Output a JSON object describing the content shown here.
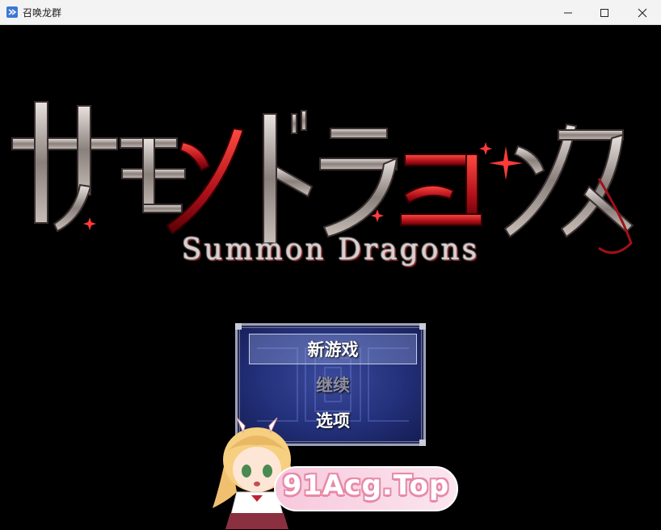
{
  "window": {
    "title": "召唤龙群",
    "minimize_icon": "minimize-icon",
    "maximize_icon": "maximize-icon",
    "close_icon": "close-icon"
  },
  "game": {
    "logo_text": "サモンドラゴンズ",
    "subtitle": "Summon Dragons",
    "menu": {
      "items": [
        {
          "label": "新游戏",
          "state": "selected"
        },
        {
          "label": "继续",
          "state": "disabled"
        },
        {
          "label": "选项",
          "state": "normal"
        }
      ]
    },
    "watermark": "91Acg.Top"
  },
  "colors": {
    "logo_red": "#c0141c",
    "logo_silver": "#b8b0ac",
    "menu_blue": "#23307a",
    "watermark_pink": "#f7c8dc"
  }
}
